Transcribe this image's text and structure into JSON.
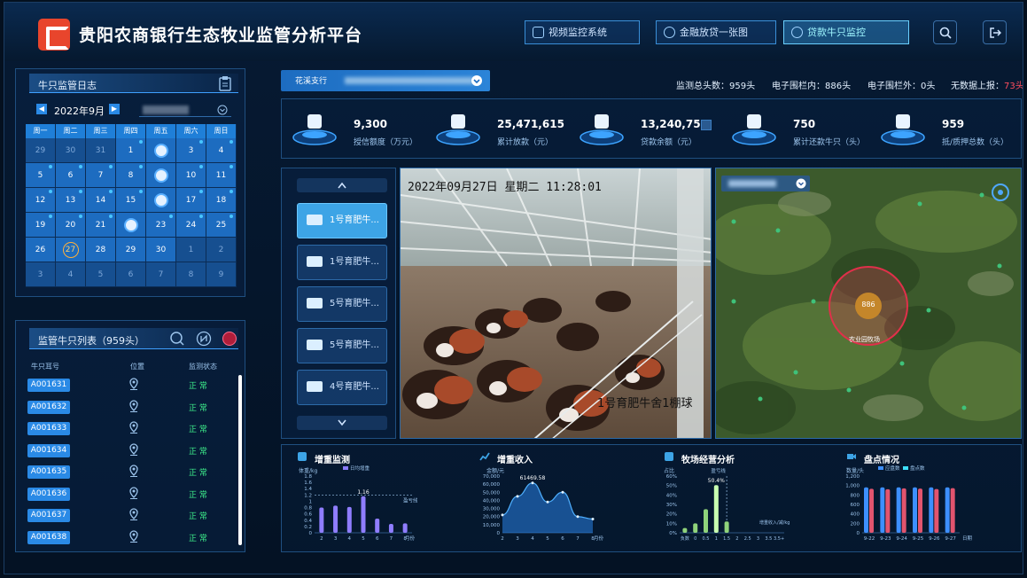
{
  "app": {
    "title": "贵阳农商银行生态牧业监管分析平台"
  },
  "nav": [
    {
      "label": "视频监控系统",
      "icon": "video-icon",
      "active": false
    },
    {
      "label": "金融放贷一张图",
      "icon": "finance-icon",
      "active": false
    },
    {
      "label": "贷款牛只监控",
      "icon": "cattle-icon",
      "active": true
    }
  ],
  "header_icons": [
    "search-icon",
    "logout-icon"
  ],
  "log": {
    "title": "牛只监管日志",
    "icon": "clipboard-icon"
  },
  "calendar": {
    "month_label": "2022年9月",
    "weekdays": [
      "周一",
      "周二",
      "周三",
      "周四",
      "周五",
      "周六",
      "周日"
    ],
    "rows": [
      [
        "29",
        "30",
        "31",
        "1",
        "",
        "3",
        "4"
      ],
      [
        "5",
        "6",
        "7",
        "8",
        "",
        "10",
        "11"
      ],
      [
        "12",
        "13",
        "14",
        "15",
        "",
        "17",
        "18"
      ],
      [
        "19",
        "20",
        "21",
        "",
        "23",
        "24",
        "25"
      ],
      [
        "26",
        "27",
        "28",
        "29",
        "30",
        "1",
        "2"
      ],
      [
        "3",
        "4",
        "5",
        "6",
        "7",
        "8",
        "9"
      ]
    ],
    "today": "27",
    "colors": {
      "header": "#1f7fd8",
      "cell": "#1d6cc0",
      "muted": "#164f90"
    }
  },
  "cow_list": {
    "title": "监管牛只列表（959头）",
    "columns": [
      "牛只耳号",
      "位置",
      "监测状态"
    ],
    "rows": [
      {
        "id": "A001631",
        "status": "正 常"
      },
      {
        "id": "A001632",
        "status": "正 常"
      },
      {
        "id": "A001633",
        "status": "正 常"
      },
      {
        "id": "A001634",
        "status": "正 常"
      },
      {
        "id": "A001635",
        "status": "正 常"
      },
      {
        "id": "A001636",
        "status": "正 常"
      },
      {
        "id": "A001637",
        "status": "正 常"
      },
      {
        "id": "A001638",
        "status": "正 常"
      }
    ]
  },
  "branch": {
    "label": "花溪支行"
  },
  "summary": {
    "total_label": "监测总头数：959头",
    "inside_label": "电子围栏内：886头",
    "outside_label": "电子围栏外：0头",
    "nodata_label": "无数据上报：",
    "nodata_value": "73头"
  },
  "stats": [
    {
      "value": "9,300",
      "label": "授信额度（万元）",
      "icon": "credit-icon"
    },
    {
      "value": "25,471,615",
      "label": "累计放款（元）",
      "icon": "loan-icon"
    },
    {
      "value": "13,240,759",
      "label": "贷款余额（元）",
      "icon": "money-bag-icon"
    },
    {
      "value": "750",
      "label": "累计还款牛只（头）",
      "icon": "repay-icon"
    },
    {
      "value": "959",
      "label": "抵/质押总数（头）",
      "icon": "cow-icon"
    }
  ],
  "cameras": [
    {
      "label": "1号育肥牛...",
      "active": true
    },
    {
      "label": "1号育肥牛...",
      "active": false
    },
    {
      "label": "5号育肥牛...",
      "active": false
    },
    {
      "label": "5号育肥牛...",
      "active": false
    },
    {
      "label": "4号育肥牛...",
      "active": false
    }
  ],
  "video": {
    "timestamp": "2022年09月27日  星期二  11:28:01",
    "caption": "1号育肥牛舍1棚球"
  },
  "map": {
    "count": "886",
    "farm_label": "农业园牧场"
  },
  "charts": {
    "weight_title": "增重监测",
    "income_title": "增重收入",
    "business_title": "牧场经营分析",
    "inventory_title": "盘点情况"
  },
  "chart_data": [
    {
      "type": "bar",
      "title": "增重监测",
      "ylabel": "体重/kg",
      "xlabel": "月份",
      "legend": "日均增重",
      "reference_label": "盈亏线",
      "reference_value": 1.2,
      "categories": [
        "2",
        "3",
        "4",
        "5",
        "6",
        "7",
        "8"
      ],
      "values": [
        0.8,
        0.86,
        0.82,
        1.16,
        0.45,
        0.28,
        0.3
      ],
      "yticks": [
        "0",
        "0.2",
        "0.4",
        "0.6",
        "0.8",
        "1",
        "1.2",
        "1.4",
        "1.6",
        "1.8"
      ],
      "ylim": [
        0,
        1.8
      ],
      "data_label": {
        "index": 3,
        "text": "1.16"
      }
    },
    {
      "type": "area",
      "title": "增重收入",
      "ylabel": "金额/元",
      "xlabel": "月份",
      "x": [
        "2",
        "3",
        "4",
        "5",
        "6",
        "7",
        "8"
      ],
      "values": [
        22000,
        45000,
        61469.58,
        38000,
        50000,
        20000,
        17000
      ],
      "yticks": [
        "0",
        "10,000",
        "20,000",
        "30,000",
        "40,000",
        "50,000",
        "60,000",
        "70,000"
      ],
      "ylim": [
        0,
        70000
      ],
      "data_label": {
        "index": 2,
        "text": "61469.58"
      }
    },
    {
      "type": "bar",
      "title": "牧场经营分析",
      "ylabel": "占比",
      "xlabel": "",
      "reference_label": "盈亏线",
      "side_label": "增重收入/减/kg",
      "categories": [
        "负数",
        "0",
        "0.5",
        "1",
        "1.5",
        "2",
        "2.5",
        "3",
        "3.5",
        "3.5+"
      ],
      "values": [
        5,
        10,
        25,
        50.4,
        12,
        0,
        0,
        0,
        0,
        0
      ],
      "yticks": [
        "0%",
        "10%",
        "20%",
        "30%",
        "40%",
        "50%",
        "60%"
      ],
      "ylim": [
        0,
        60
      ],
      "data_label": {
        "index": 3,
        "text": "50.4%"
      }
    },
    {
      "type": "bar",
      "title": "盘点情况",
      "ylabel": "数量/头",
      "xlabel": "日期",
      "series": [
        {
          "name": "应盘数",
          "color": "#3d8fff"
        },
        {
          "name": "盘点数",
          "color": "#3de0ff"
        }
      ],
      "categories": [
        "9-22",
        "9-23",
        "9-24",
        "9-25",
        "9-26",
        "9-27"
      ],
      "values_a": [
        960,
        960,
        960,
        960,
        960,
        960
      ],
      "values_b": [
        930,
        920,
        940,
        935,
        925,
        945
      ],
      "yticks": [
        "0",
        "200",
        "400",
        "600",
        "800",
        "1,000",
        "1,200"
      ],
      "ylim": [
        0,
        1200
      ]
    }
  ]
}
